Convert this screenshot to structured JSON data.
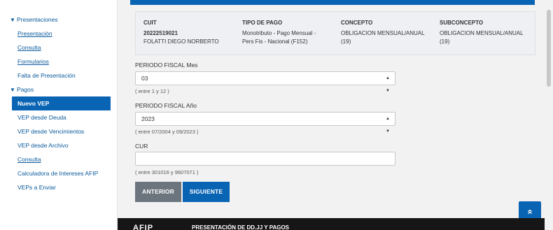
{
  "sidebar": {
    "sections": [
      {
        "label": "Presentaciones"
      },
      {
        "label": "Pagos"
      }
    ],
    "presentaciones_items": [
      {
        "label": "Presentación"
      },
      {
        "label": "Consulta"
      },
      {
        "label": "Formularios"
      },
      {
        "label": "Falta de Presentación"
      }
    ],
    "pagos_items": [
      {
        "label": "Nuevo VEP"
      },
      {
        "label": "VEP desde Deuda"
      },
      {
        "label": "VEP desde Vencimientos"
      },
      {
        "label": "VEP desde Archivo"
      },
      {
        "label": "Consulta"
      },
      {
        "label": "Calculadora de Intereses AFIP"
      },
      {
        "label": "VEPs a Enviar"
      }
    ]
  },
  "info": {
    "cuit": {
      "header": "CUIT",
      "number": "20222519021",
      "name": "FOLATTI DIEGO NORBERTO"
    },
    "tipo_pago": {
      "header": "TIPO DE PAGO",
      "line1": "Monotributo - Pago Mensual -",
      "line2": "Pers Fis - Nacional (F152)"
    },
    "concepto": {
      "header": "CONCEPTO",
      "line1": "OBLIGACION MENSUAL/ANUAL",
      "line2": "(19)"
    },
    "subconcepto": {
      "header": "SUBCONCEPTO",
      "line1": "OBLIGACION MENSUAL/ANUAL",
      "line2": "(19)"
    }
  },
  "form": {
    "mes": {
      "label": "PERIODO FISCAL Mes",
      "value": "03",
      "hint": "( entre 1 y 12 )"
    },
    "anio": {
      "label": "PERIODO FISCAL Año",
      "value": "2023",
      "hint": "( entre 07/2004 y 09/2023 )"
    },
    "cur": {
      "label": "CUR",
      "value": "",
      "hint": "( entre 301016 y 9607071 )"
    }
  },
  "buttons": {
    "prev": "ANTERIOR",
    "next": "SIGUIENTE"
  },
  "back_to_top": "»",
  "footer": {
    "logo": "AFIP",
    "title": "PRESENTACIÓN DE DD.JJ Y PAGOS"
  },
  "colors": {
    "primary": "#0a64b4",
    "secondary": "#6c757d",
    "footer": "#161616"
  }
}
